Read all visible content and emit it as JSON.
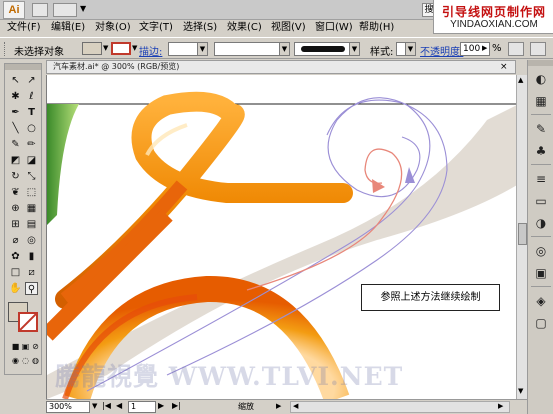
{
  "app": {
    "logo": "Ai",
    "search_glyph": "搜"
  },
  "watermark": {
    "title": "引导线网页制作网",
    "url": "YINDAOXIAN.COM",
    "bottom": "騰龍視覺 WWW.TLVI.NET"
  },
  "menu": [
    {
      "label": "文件(F)"
    },
    {
      "label": "编辑(E)"
    },
    {
      "label": "对象(O)"
    },
    {
      "label": "文字(T)"
    },
    {
      "label": "选择(S)"
    },
    {
      "label": "效果(C)"
    },
    {
      "label": "视图(V)"
    },
    {
      "label": "窗口(W)"
    },
    {
      "label": "帮助(H)"
    }
  ],
  "control": {
    "no_selection": "未选择对象",
    "stroke_label": "描边:",
    "style_label": "样式:",
    "opacity_label": "不透明度:",
    "opacity_value": "100",
    "opacity_unit": "%",
    "stroke_color": "#c0392b",
    "fill_color": "#d8d0c0"
  },
  "document": {
    "tab_title": "汽车素材.ai* @ 300% (RGB/预览)",
    "callout": "参照上述方法继续绘制"
  },
  "status": {
    "zoom": "300%",
    "page": "1",
    "info": "缩放"
  },
  "colors": {
    "orange": "#f39c12",
    "orange_dark": "#d35400",
    "spiral_blue": "#9b8fd6",
    "spiral_red": "#e8877a",
    "band": "#ddd6cc"
  }
}
